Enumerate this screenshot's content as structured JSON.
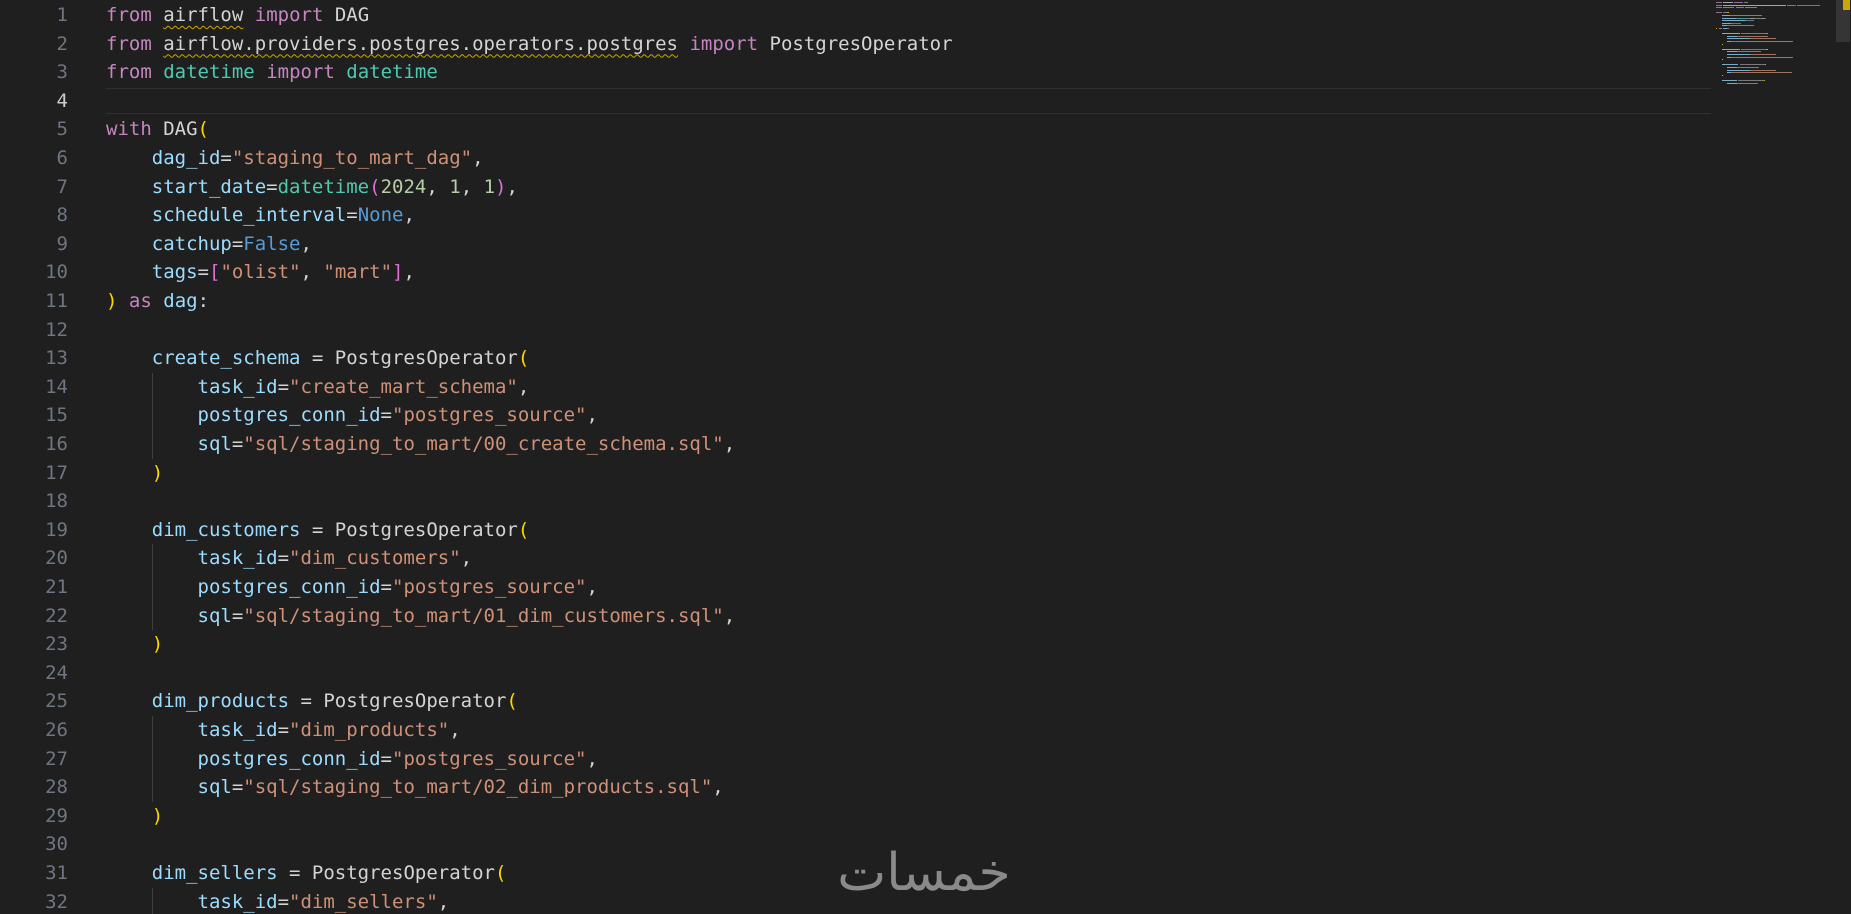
{
  "editor": {
    "language": "python",
    "active_line": 4,
    "colors": {
      "background": "#1f1f1f",
      "keyword": "#c586c0",
      "string": "#ce9178",
      "number": "#b5cea8",
      "constant": "#569cd6",
      "class": "#4ec9b0",
      "parameter": "#9cdcfe",
      "bracket_level1": "#ffd700",
      "bracket_level2": "#da70d6",
      "warning_squiggle": "#cca700"
    },
    "lines": [
      {
        "n": "1",
        "tokens": [
          [
            "kw",
            "from"
          ],
          [
            "",
            "",
            " "
          ],
          [
            "sq",
            "airflow"
          ],
          [
            "",
            " "
          ],
          [
            "kw",
            "import"
          ],
          [
            "",
            " DAG"
          ]
        ]
      },
      {
        "n": "2",
        "tokens": [
          [
            "kw",
            "from"
          ],
          [
            "",
            " "
          ],
          [
            "sq",
            "airflow.providers.postgres.operators.postgres"
          ],
          [
            "",
            " "
          ],
          [
            "kw",
            "import"
          ],
          [
            "",
            " PostgresOperator"
          ]
        ]
      },
      {
        "n": "3",
        "tokens": [
          [
            "kw",
            "from"
          ],
          [
            "",
            " "
          ],
          [
            "cl",
            "datetime"
          ],
          [
            "",
            " "
          ],
          [
            "kw",
            "import"
          ],
          [
            "",
            " "
          ],
          [
            "cl",
            "datetime"
          ]
        ]
      },
      {
        "n": "4",
        "tokens": []
      },
      {
        "n": "5",
        "tokens": [
          [
            "kw",
            "with"
          ],
          [
            "",
            " DAG"
          ],
          [
            "b1",
            "("
          ]
        ]
      },
      {
        "n": "6",
        "tokens": [
          [
            "",
            "    "
          ],
          [
            "pm",
            "dag_id"
          ],
          [
            "",
            "="
          ],
          [
            "st",
            "\"staging_to_mart_dag\""
          ],
          [
            "",
            ","
          ]
        ]
      },
      {
        "n": "7",
        "tokens": [
          [
            "",
            "    "
          ],
          [
            "pm",
            "start_date"
          ],
          [
            "",
            "="
          ],
          [
            "cl",
            "datetime"
          ],
          [
            "b2",
            "("
          ],
          [
            "nm",
            "2024"
          ],
          [
            "",
            ", "
          ],
          [
            "nm",
            "1"
          ],
          [
            "",
            ", "
          ],
          [
            "nm",
            "1"
          ],
          [
            "b2",
            ")"
          ],
          [
            "",
            ","
          ]
        ]
      },
      {
        "n": "8",
        "tokens": [
          [
            "",
            "    "
          ],
          [
            "pm",
            "schedule_interval"
          ],
          [
            "",
            "="
          ],
          [
            "bl",
            "None"
          ],
          [
            "",
            ","
          ]
        ]
      },
      {
        "n": "9",
        "tokens": [
          [
            "",
            "    "
          ],
          [
            "pm",
            "catchup"
          ],
          [
            "",
            "="
          ],
          [
            "bl",
            "False"
          ],
          [
            "",
            ","
          ]
        ]
      },
      {
        "n": "10",
        "tokens": [
          [
            "",
            "    "
          ],
          [
            "pm",
            "tags"
          ],
          [
            "",
            "="
          ],
          [
            "b2",
            "["
          ],
          [
            "st",
            "\"olist\""
          ],
          [
            "",
            ", "
          ],
          [
            "st",
            "\"mart\""
          ],
          [
            "b2",
            "]"
          ],
          [
            "",
            ","
          ]
        ]
      },
      {
        "n": "11",
        "tokens": [
          [
            "b1",
            ")"
          ],
          [
            "",
            " "
          ],
          [
            "kw",
            "as"
          ],
          [
            "",
            " "
          ],
          [
            "pm",
            "dag"
          ],
          [
            "",
            ":"
          ]
        ]
      },
      {
        "n": "12",
        "tokens": []
      },
      {
        "n": "13",
        "tokens": [
          [
            "",
            "    "
          ],
          [
            "pm",
            "create_schema"
          ],
          [
            "",
            " = PostgresOperator"
          ],
          [
            "b1",
            "("
          ]
        ]
      },
      {
        "n": "14",
        "tokens": [
          [
            "",
            "        "
          ],
          [
            "pm",
            "task_id"
          ],
          [
            "",
            "="
          ],
          [
            "st",
            "\"create_mart_schema\""
          ],
          [
            "",
            ","
          ]
        ]
      },
      {
        "n": "15",
        "tokens": [
          [
            "",
            "        "
          ],
          [
            "pm",
            "postgres_conn_id"
          ],
          [
            "",
            "="
          ],
          [
            "st",
            "\"postgres_source\""
          ],
          [
            "",
            ","
          ]
        ]
      },
      {
        "n": "16",
        "tokens": [
          [
            "",
            "        "
          ],
          [
            "pm",
            "sql"
          ],
          [
            "",
            "="
          ],
          [
            "st",
            "\"sql/staging_to_mart/00_create_schema.sql\""
          ],
          [
            "",
            ","
          ]
        ]
      },
      {
        "n": "17",
        "tokens": [
          [
            "",
            "    "
          ],
          [
            "b1",
            ")"
          ]
        ]
      },
      {
        "n": "18",
        "tokens": []
      },
      {
        "n": "19",
        "tokens": [
          [
            "",
            "    "
          ],
          [
            "pm",
            "dim_customers"
          ],
          [
            "",
            " = PostgresOperator"
          ],
          [
            "b1",
            "("
          ]
        ]
      },
      {
        "n": "20",
        "tokens": [
          [
            "",
            "        "
          ],
          [
            "pm",
            "task_id"
          ],
          [
            "",
            "="
          ],
          [
            "st",
            "\"dim_customers\""
          ],
          [
            "",
            ","
          ]
        ]
      },
      {
        "n": "21",
        "tokens": [
          [
            "",
            "        "
          ],
          [
            "pm",
            "postgres_conn_id"
          ],
          [
            "",
            "="
          ],
          [
            "st",
            "\"postgres_source\""
          ],
          [
            "",
            ","
          ]
        ]
      },
      {
        "n": "22",
        "tokens": [
          [
            "",
            "        "
          ],
          [
            "pm",
            "sql"
          ],
          [
            "",
            "="
          ],
          [
            "st",
            "\"sql/staging_to_mart/01_dim_customers.sql\""
          ],
          [
            "",
            ","
          ]
        ]
      },
      {
        "n": "23",
        "tokens": [
          [
            "",
            "    "
          ],
          [
            "b1",
            ")"
          ]
        ]
      },
      {
        "n": "24",
        "tokens": []
      },
      {
        "n": "25",
        "tokens": [
          [
            "",
            "    "
          ],
          [
            "pm",
            "dim_products"
          ],
          [
            "",
            " = PostgresOperator"
          ],
          [
            "b1",
            "("
          ]
        ]
      },
      {
        "n": "26",
        "tokens": [
          [
            "",
            "        "
          ],
          [
            "pm",
            "task_id"
          ],
          [
            "",
            "="
          ],
          [
            "st",
            "\"dim_products\""
          ],
          [
            "",
            ","
          ]
        ]
      },
      {
        "n": "27",
        "tokens": [
          [
            "",
            "        "
          ],
          [
            "pm",
            "postgres_conn_id"
          ],
          [
            "",
            "="
          ],
          [
            "st",
            "\"postgres_source\""
          ],
          [
            "",
            ","
          ]
        ]
      },
      {
        "n": "28",
        "tokens": [
          [
            "",
            "        "
          ],
          [
            "pm",
            "sql"
          ],
          [
            "",
            "="
          ],
          [
            "st",
            "\"sql/staging_to_mart/02_dim_products.sql\""
          ],
          [
            "",
            ","
          ]
        ]
      },
      {
        "n": "29",
        "tokens": [
          [
            "",
            "    "
          ],
          [
            "b1",
            ")"
          ]
        ]
      },
      {
        "n": "30",
        "tokens": []
      },
      {
        "n": "31",
        "tokens": [
          [
            "",
            "    "
          ],
          [
            "pm",
            "dim_sellers"
          ],
          [
            "",
            " = PostgresOperator"
          ],
          [
            "b1",
            "("
          ]
        ]
      },
      {
        "n": "32",
        "tokens": [
          [
            "",
            "        "
          ],
          [
            "pm",
            "task_id"
          ],
          [
            "",
            "="
          ],
          [
            "st",
            "\"dim_sellers\""
          ],
          [
            "",
            ","
          ]
        ]
      }
    ]
  },
  "watermark": {
    "text": "خمسات",
    "color": "#8a8a8a"
  }
}
